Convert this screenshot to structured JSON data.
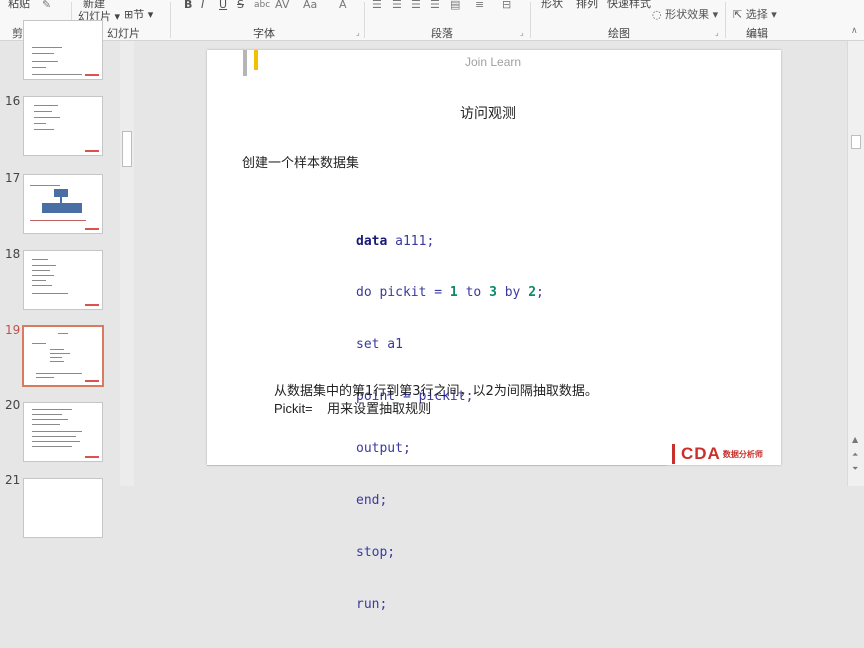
{
  "ribbon": {
    "clipboard_cut": "粘贴",
    "new_slide_cut": "新建",
    "new_slide_label": "幻灯片",
    "section_label": "节",
    "shape_cut": "形状",
    "arrange_cut": "排列",
    "quick_style_cut": "快速样式",
    "shape_effects_label": "形状效果",
    "select_label": "选择",
    "font_buttons": [
      "B",
      "I",
      "U",
      "S",
      "abc",
      "AV",
      "Aa",
      "A"
    ],
    "groups": [
      "剪贴板",
      "幻灯片",
      "字体",
      "段落",
      "绘图",
      "编辑"
    ]
  },
  "thumbnails": [
    {
      "number": "",
      "selected": false
    },
    {
      "number": "16",
      "selected": false
    },
    {
      "number": "17",
      "selected": false
    },
    {
      "number": "18",
      "selected": false
    },
    {
      "number": "19",
      "selected": true
    },
    {
      "number": "20",
      "selected": false
    },
    {
      "number": "21",
      "selected": false
    }
  ],
  "slide": {
    "brand": "Join Learn",
    "title": "访问观测",
    "intro": "创建一个样本数据集",
    "code_lines": [
      "data a111;",
      "do pickit = 1 to 3 by 2;",
      "set a1",
      "point = pickit;",
      "output;",
      "end;",
      "stop;",
      "run;"
    ],
    "footer_line1": "从数据集中的第1行到第3行之间，以2为间隔抽取数据。",
    "footer_line2": "Pickit=    用来设置抽取规则",
    "logo_text": "CDA",
    "logo_sub": "数据分析师"
  }
}
